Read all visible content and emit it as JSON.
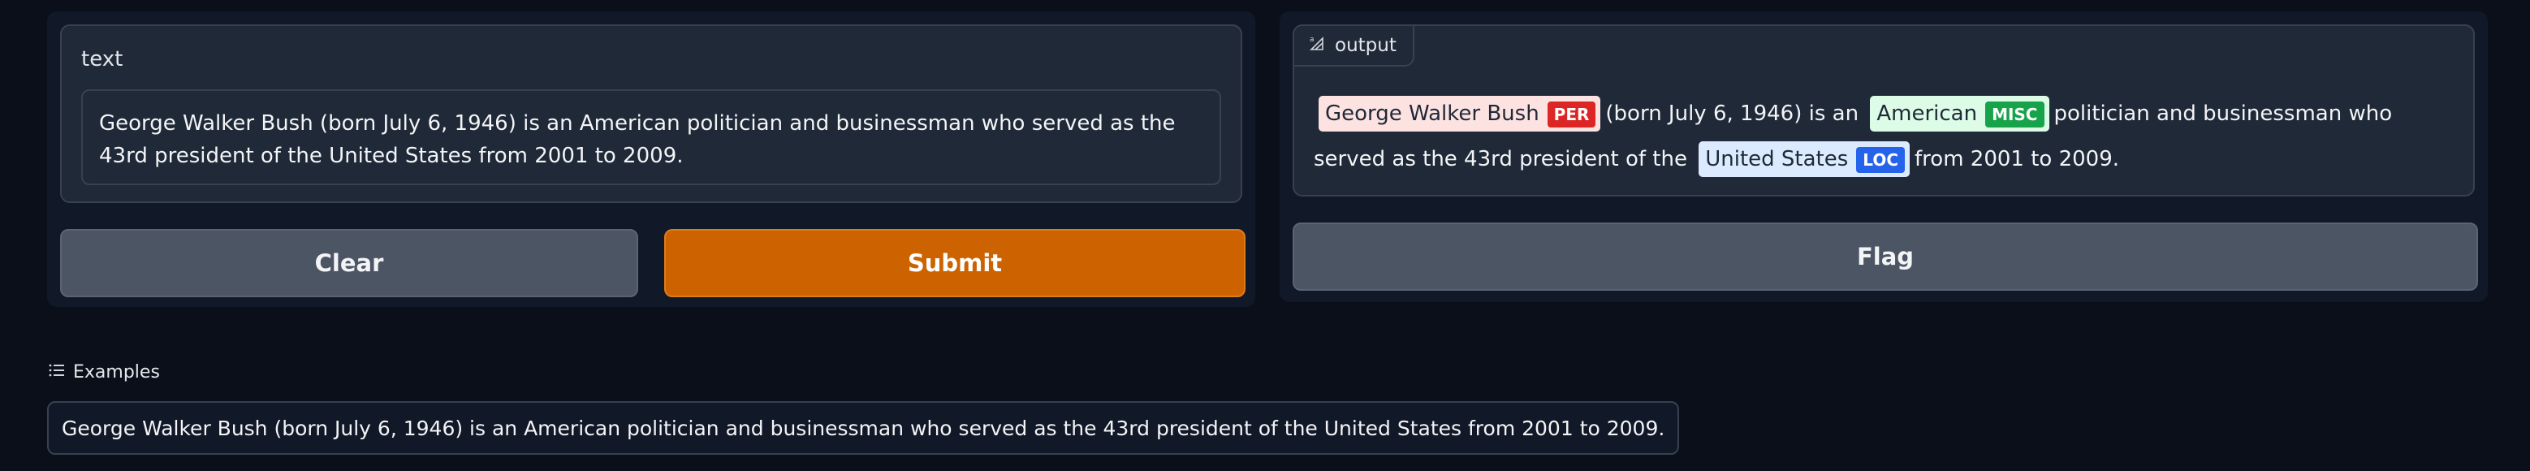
{
  "input": {
    "label": "text",
    "value": "George Walker Bush (born July 6, 1946) is an American politician and businessman who served as the 43rd president of the United States from 2001 to 2009."
  },
  "buttons": {
    "clear": "Clear",
    "submit": "Submit",
    "flag": "Flag"
  },
  "output": {
    "label": "output",
    "segments": {
      "t0": "",
      "e1": {
        "text": "George Walker Bush",
        "label": "PER",
        "color": "#dc2626",
        "bg": "#fde2e2"
      },
      "t1": "(born July 6, 1946) is an",
      "e2": {
        "text": "American",
        "label": "MISC",
        "color": "#16a34a",
        "bg": "#dcfce7"
      },
      "t2": "politician and businessman who served as the 43rd president of the",
      "e3": {
        "text": "United States",
        "label": "LOC",
        "color": "#2563eb",
        "bg": "#dbeafe"
      },
      "t3": "from 2001 to 2009."
    }
  },
  "examples": {
    "label": "Examples",
    "items": [
      "George Walker Bush (born July 6, 1946) is an American politician and businessman who served as the 43rd president of the United States from 2001 to 2009."
    ]
  },
  "colors": {
    "background": "#0b0f19",
    "panel": "#111827",
    "block": "#1f2937",
    "submit": "#cc6300",
    "secondary_button": "#4b5563"
  }
}
